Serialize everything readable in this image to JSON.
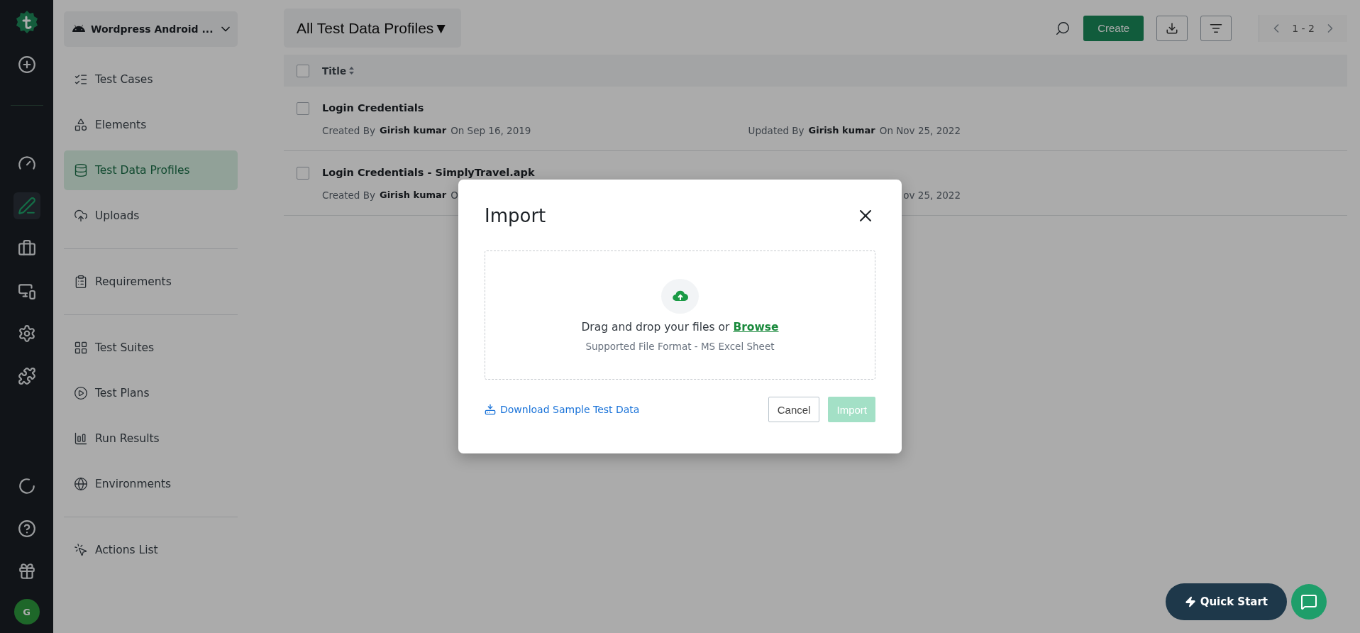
{
  "rail": {
    "top_items": [
      {
        "selected": false
      },
      {
        "selected": false
      },
      {
        "selected": true
      },
      {
        "selected": false
      },
      {
        "selected": false
      },
      {
        "selected": false
      },
      {
        "selected": false
      }
    ],
    "bottom_items": [
      {
        "selected": false
      },
      {
        "selected": false
      },
      {
        "selected": false
      }
    ],
    "avatar": "G"
  },
  "sidebar": {
    "project": "Wordpress Android ...",
    "sections": [
      {
        "items": [
          {
            "label": "Test Cases",
            "selected": false
          },
          {
            "label": "Elements",
            "selected": false
          },
          {
            "label": "Test Data Profiles",
            "selected": true
          },
          {
            "label": "Uploads",
            "selected": false
          }
        ]
      },
      {
        "items": [
          {
            "label": "Requirements",
            "selected": false
          }
        ]
      },
      {
        "items": [
          {
            "label": "Test Suites",
            "selected": false
          },
          {
            "label": "Test Plans",
            "selected": false
          },
          {
            "label": "Run Results",
            "selected": false
          },
          {
            "label": "Environments",
            "selected": false
          }
        ]
      },
      {
        "items": [
          {
            "label": "Actions List",
            "selected": false
          }
        ]
      }
    ]
  },
  "header": {
    "view": "All Test Data Profiles",
    "caret": "▼",
    "create": "Create",
    "pagination": "1 - 2"
  },
  "table": {
    "columns": [
      {
        "label": "Title",
        "checked": false
      }
    ],
    "rows": [
      {
        "title": "Login Credentials",
        "checked": false,
        "created_label": "Created By",
        "created_by": "Girish kumar",
        "created_on": "On Sep 16, 2019",
        "updated_label": "Updated By",
        "updated_by": "Girish kumar",
        "updated_on": "On Nov 25, 2022"
      },
      {
        "title": "Login Credentials - SimplyTravel.apk",
        "checked": false,
        "created_label": "Created By",
        "created_by": "Girish kumar",
        "created_on": "O",
        "updated_on": "ov 25, 2022"
      }
    ]
  },
  "modal": {
    "title": "Import",
    "drop_text": "Drag and drop your files or",
    "browse": "Browse",
    "hint": "Supported File Format - MS Excel Sheet",
    "download_link": "Download Sample Test Data",
    "cancel": "Cancel",
    "import": "Import",
    "import_disabled": true
  },
  "quick_start": "Quick Start"
}
